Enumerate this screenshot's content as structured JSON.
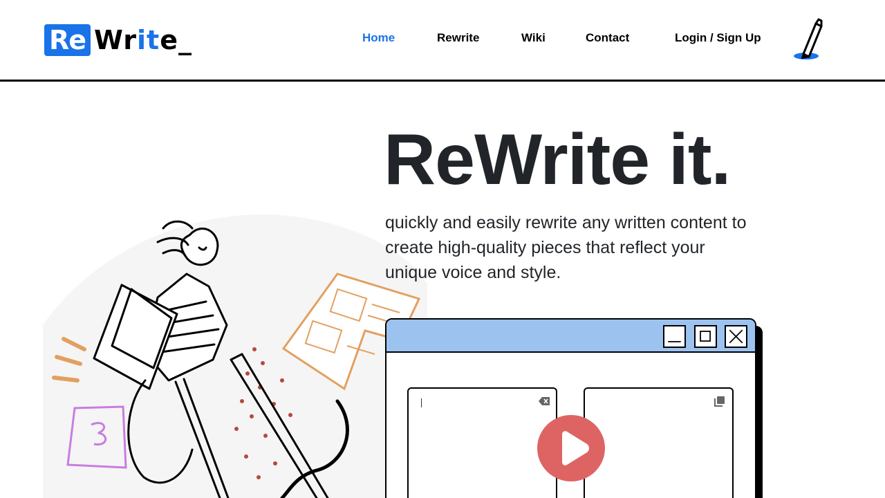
{
  "logo": {
    "part1": "Re",
    "part2": "Wr",
    "part3": "it",
    "part4": "e_"
  },
  "nav": {
    "items": [
      {
        "label": "Home",
        "active": true
      },
      {
        "label": "Rewrite",
        "active": false
      },
      {
        "label": "Wiki",
        "active": false
      },
      {
        "label": "Contact",
        "active": false
      },
      {
        "label": "Login / Sign Up",
        "active": false
      }
    ]
  },
  "hero": {
    "title": "ReWrite it.",
    "subtitle": "quickly and easily rewrite any written content to create high-quality pieces that reflect your unique voice and style."
  },
  "icons": {
    "pen": "pen-icon",
    "minimize": "minimize-icon",
    "maximize": "maximize-icon",
    "close": "close-icon",
    "clear": "backspace-icon",
    "copy": "copy-icon",
    "play": "play-icon"
  },
  "colors": {
    "accent": "#1a73e8",
    "titlebar": "#9cc3f0",
    "play": "#de6464",
    "text": "#212529"
  }
}
